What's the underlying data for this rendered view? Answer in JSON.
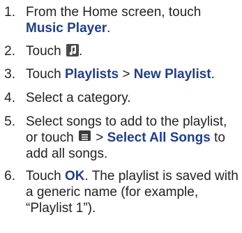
{
  "steps": [
    {
      "num": "1.",
      "pre": "From the Home screen, touch",
      "link": "Music Player",
      "post": "."
    },
    {
      "num": "2.",
      "pre": "Touch",
      "icon": "music-note-icon",
      "post": "."
    },
    {
      "num": "3.",
      "pre": "Touch",
      "link1": "Playlists",
      "sep": " > ",
      "link2": "New Playlist",
      "post": "."
    },
    {
      "num": "4.",
      "text": "Select a category."
    },
    {
      "num": "5.",
      "pre": "Select songs to add to the playlist, or touch",
      "icon": "menu-icon",
      "sep": " > ",
      "link": "Select All Songs",
      "post": " to add all songs."
    },
    {
      "num": "6.",
      "pre": "Touch",
      "link": "OK",
      "post": ". The playlist is saved with a generic name (for example, “Playlist 1”)."
    }
  ],
  "colors": {
    "link": "#1f3f86",
    "text": "#222222"
  }
}
